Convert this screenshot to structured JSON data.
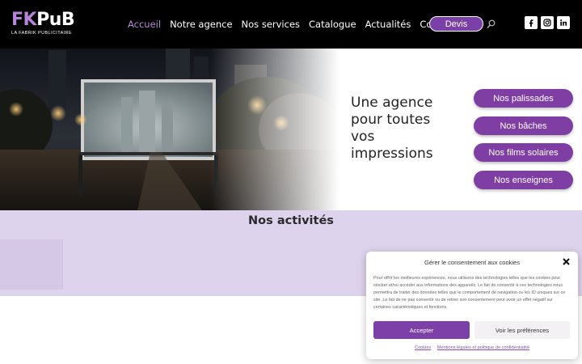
{
  "header": {
    "logo": {
      "main_prefix": "FK",
      "main_suffix": "PuB",
      "tagline": "LA FABRIK PUBLICITAIRE"
    },
    "nav": [
      {
        "label": "Accueil",
        "active": true
      },
      {
        "label": "Notre agence",
        "active": false
      },
      {
        "label": "Nos services",
        "active": false
      },
      {
        "label": "Catalogue",
        "active": false
      },
      {
        "label": "Actualités",
        "active": false
      },
      {
        "label": "Contact",
        "active": false
      }
    ],
    "devis_label": "Devis",
    "search_icon": "search-icon",
    "social_icons": [
      "facebook-icon",
      "instagram-icon",
      "linkedin-icon"
    ]
  },
  "hero": {
    "title_lines": [
      "Une agence",
      "pour toutes",
      "vos",
      "impressions"
    ],
    "buttons": [
      "Nos palissades",
      "Nos bâches",
      "Nos films solaires",
      "Nos enseignes"
    ]
  },
  "activities": {
    "title": "Nos activités"
  },
  "cookie_banner": {
    "title": "Gérer le consentement aux cookies",
    "text": "Pour offrir les meilleures expériences, nous utilisons des technologies telles que les cookies pour stocker et/ou accéder aux informations des appareils. Le fait de consentir à ces technologies nous permettra de traiter des données telles que le comportement de navigation ou les ID uniques sur ce site. Le fait de ne pas consentir ou de retirer son consentement peut avoir un effet négatif sur certaines caractéristiques et fonctions.",
    "accept_label": "Accepter",
    "preferences_label": "Voir les préférences",
    "links": [
      "Cookies",
      "Mentions légales et politique de confidentialité"
    ]
  },
  "colors": {
    "brand_purple": "#7e3ea4",
    "nav_active": "#b98ad8",
    "activities_bg": "#ddd3ec",
    "header_bg": "#000000"
  }
}
